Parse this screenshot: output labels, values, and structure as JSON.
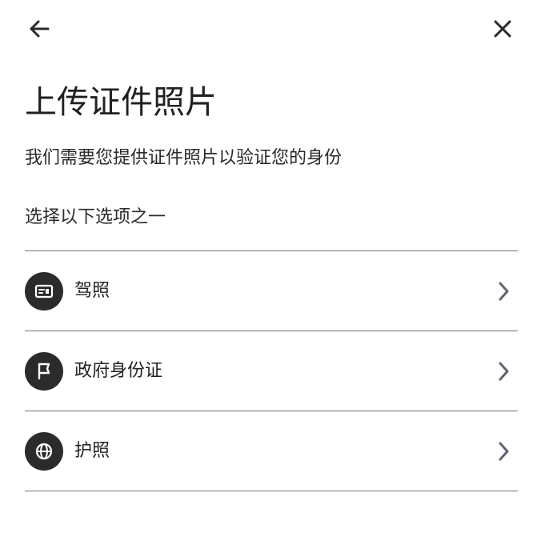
{
  "header": {
    "back_icon": "arrow-left-icon",
    "close_icon": "close-icon"
  },
  "page": {
    "title": "上传证件照片",
    "subtitle": "我们需要您提供证件照片以验证您的身份",
    "prompt": "选择以下选项之一"
  },
  "options": [
    {
      "label": "驾照",
      "icon": "id-card-icon"
    },
    {
      "label": "政府身份证",
      "icon": "flag-icon"
    },
    {
      "label": "护照",
      "icon": "globe-icon"
    }
  ],
  "colors": {
    "icon_circle": "#2b2b2b",
    "divider": "#6f7382",
    "chevron": "#5f6370",
    "text": "#222222"
  }
}
